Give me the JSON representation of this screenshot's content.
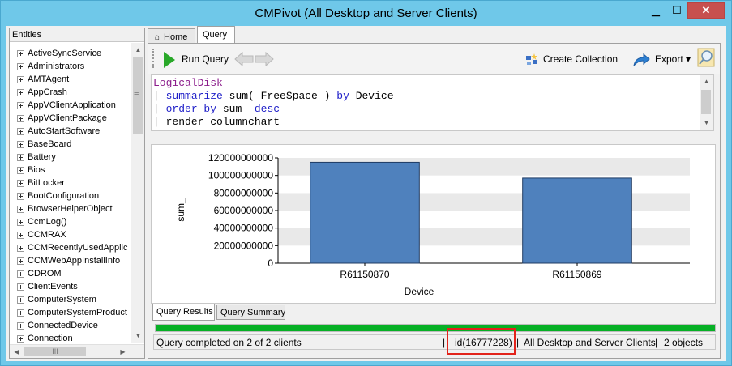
{
  "window": {
    "title": "CMPivot (All Desktop and Server Clients)",
    "minimize_glyph": "▁",
    "maximize_glyph": "☐",
    "close_glyph": "✕"
  },
  "entities": {
    "header": "Entities",
    "items": [
      "ActiveSyncService",
      "Administrators",
      "AMTAgent",
      "AppCrash",
      "AppVClientApplication",
      "AppVClientPackage",
      "AutoStartSoftware",
      "BaseBoard",
      "Battery",
      "Bios",
      "BitLocker",
      "BootConfiguration",
      "BrowserHelperObject",
      "CcmLog()",
      "CCMRAX",
      "CCMRecentlyUsedApplic",
      "CCMWebAppInstallInfo",
      "CDROM",
      "ClientEvents",
      "ComputerSystem",
      "ComputerSystemProduct",
      "ConnectedDevice",
      "Connection"
    ],
    "scroll_up_glyph": "▲",
    "scroll_down_glyph": "▼",
    "scroll_left_glyph": "◀",
    "scroll_right_glyph": "▶",
    "hthumb_glyph": "III"
  },
  "tabs": {
    "home": "Home",
    "home_icon": "home-icon",
    "query": "Query"
  },
  "toolbar": {
    "run_query": "Run Query",
    "create_collection": "Create Collection",
    "export": "Export",
    "export_dropdown_glyph": "▾"
  },
  "query": {
    "line1_table": "LogicalDisk",
    "line2_kw": "summarize",
    "line2_rest": " sum( FreeSpace ) ",
    "line2_kw2": "by",
    "line2_rest2": " Device",
    "line3_kw": "order by",
    "line3_rest": " sum_ ",
    "line3_kw2": "desc",
    "line4_kw": "render",
    "line4_rest": " columnchart",
    "bar_glyph": "|"
  },
  "chart_data": {
    "type": "bar",
    "categories": [
      "R61150870",
      "R61150869"
    ],
    "values": [
      115000000000,
      97000000000
    ],
    "ylabel": "sum_",
    "xlabel": "Device",
    "ylim": [
      0,
      120000000000
    ],
    "yticks": [
      "0",
      "20000000000",
      "40000000000",
      "60000000000",
      "80000000000",
      "100000000000",
      "120000000000"
    ],
    "bar_color": "#4f81bd",
    "grid": true
  },
  "result_tabs": {
    "results": "Query Results",
    "summary": "Query Summary"
  },
  "progress": {
    "value": 1.0,
    "color": "#06b025"
  },
  "status": {
    "text": "Query completed on 2 of 2 clients",
    "id": "id(16777228)",
    "separator": "|",
    "collection": "All Desktop and Server Clients",
    "count": "2 objects"
  }
}
